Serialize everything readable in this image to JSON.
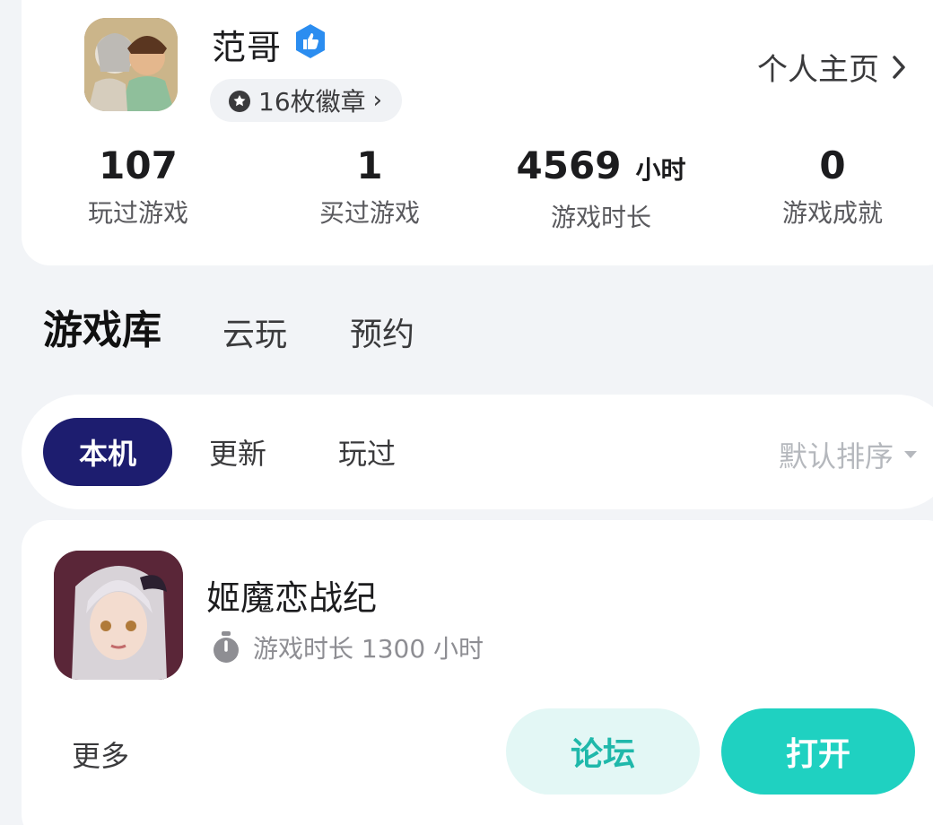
{
  "profile": {
    "username": "范哥",
    "badges_label": "16枚徽章",
    "homepage_label": "个人主页",
    "stats": [
      {
        "value": "107",
        "unit": "",
        "label": "玩过游戏"
      },
      {
        "value": "1",
        "unit": "",
        "label": "买过游戏"
      },
      {
        "value": "4569",
        "unit": "小时",
        "label": "游戏时长"
      },
      {
        "value": "0",
        "unit": "",
        "label": "游戏成就"
      }
    ]
  },
  "main_tabs": [
    {
      "label": "游戏库",
      "active": true
    },
    {
      "label": "云玩",
      "active": false
    },
    {
      "label": "预约",
      "active": false
    }
  ],
  "filter": {
    "tabs": [
      {
        "label": "本机",
        "active": true
      },
      {
        "label": "更新",
        "active": false
      },
      {
        "label": "玩过",
        "active": false
      }
    ],
    "sort_label": "默认排序"
  },
  "game": {
    "title": "姬魔恋战纪",
    "playtime_label": "游戏时长 1300 小时",
    "more_label": "更多",
    "forum_label": "论坛",
    "open_label": "打开"
  },
  "colors": {
    "accent_teal": "#1fd1c1",
    "active_filter": "#1d1d6f",
    "verified_blue": "#2b8df0",
    "background": "#f2f4f7"
  },
  "icons": {
    "verified": "thumbs-up-verified-icon",
    "badge": "medal-icon",
    "homepage": "chevron-right-icon",
    "sort": "caret-down-icon",
    "playtime": "stopwatch-icon"
  }
}
